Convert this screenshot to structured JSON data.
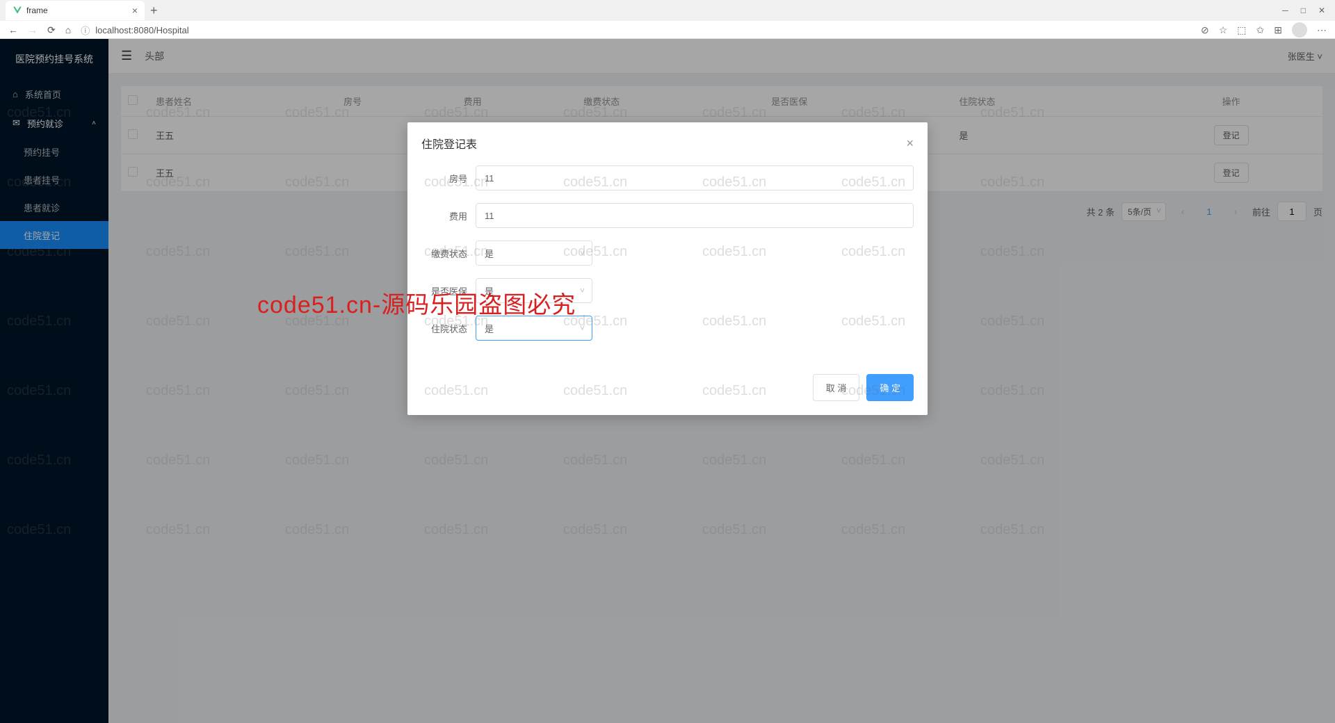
{
  "browser": {
    "tab_title": "frame",
    "url": "localhost:8080/Hospital"
  },
  "sidebar": {
    "brand": "医院预约挂号系统",
    "items": [
      {
        "label": "系统首页",
        "icon": "home"
      },
      {
        "label": "预约就诊",
        "icon": "mail",
        "expanded": true
      }
    ],
    "submenu": [
      {
        "label": "预约挂号"
      },
      {
        "label": "患者挂号"
      },
      {
        "label": "患者就诊"
      },
      {
        "label": "住院登记",
        "active": true
      }
    ]
  },
  "topbar": {
    "title": "头部",
    "user": "张医生"
  },
  "table": {
    "headers": [
      "患者姓名",
      "房号",
      "费用",
      "缴费状态",
      "是否医保",
      "住院状态",
      "操作"
    ],
    "rows": [
      {
        "name": "王五",
        "room": "",
        "fee": "",
        "pay": "",
        "ins": "",
        "status": "是",
        "op": "登记"
      },
      {
        "name": "王五",
        "room": "",
        "fee": "",
        "pay": "",
        "ins": "",
        "status": "",
        "op": "登记"
      }
    ]
  },
  "pagination": {
    "total_text": "共 2 条",
    "per_page": "5条/页",
    "current": "1",
    "goto_label": "前往",
    "goto_value": "1",
    "page_suffix": "页"
  },
  "dialog": {
    "title": "住院登记表",
    "fields": {
      "room_label": "房号",
      "room_value": "11",
      "fee_label": "费用",
      "fee_value": "11",
      "pay_label": "缴费状态",
      "pay_value": "是",
      "ins_label": "是否医保",
      "ins_value": "是",
      "status_label": "住院状态",
      "status_value": "是"
    },
    "cancel": "取 消",
    "confirm": "确 定"
  },
  "watermark": {
    "text": "code51.cn",
    "red_text": "code51.cn-源码乐园盗图必究"
  }
}
